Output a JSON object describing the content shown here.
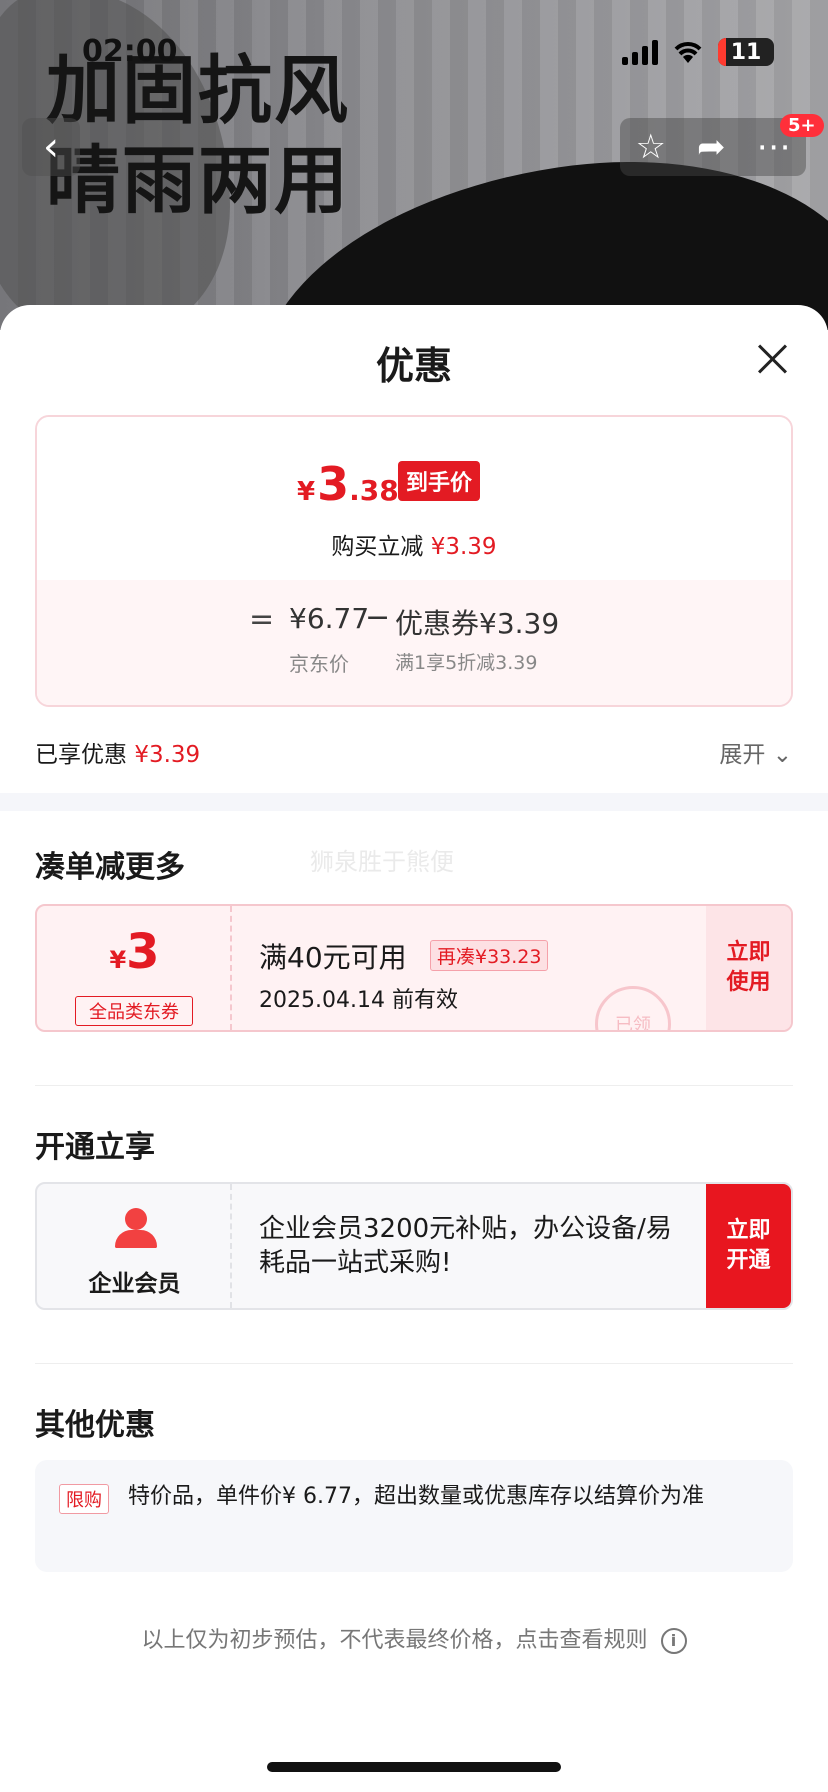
{
  "status_bar": {
    "time": "02:00",
    "battery": "11"
  },
  "hero": {
    "headline_line1": "加固抗风",
    "headline_line2": "晴雨两用",
    "badge": "5+"
  },
  "sheet": {
    "title": "优惠",
    "price": {
      "final_yen": "¥",
      "final_int": "3",
      "final_dec": ".38",
      "final_tag": "到手价",
      "reduce_text": "购买立减",
      "reduce_value": "¥3.39",
      "equals": "=",
      "jd_price": "¥6.77",
      "jd_label": "京东价",
      "minus": "−",
      "coupon_value": "优惠券¥3.39",
      "coupon_desc": "满1享5折减3.39"
    },
    "enjoyed_label": "已享优惠",
    "enjoyed_value": "¥3.39",
    "expand_label": "展开 ⌄",
    "watermark": "狮泉胜于熊便"
  },
  "section_more": {
    "title": "凑单减更多",
    "coupon": {
      "yen": "¥",
      "amount": "3",
      "kind": "全品类东券",
      "condition": "满40元可用",
      "more": "再凑¥33.23",
      "valid": "2025.04.14 前有效",
      "use_label": "立即\n使用",
      "stamp": "已领"
    }
  },
  "section_open": {
    "title": "开通立享",
    "member": {
      "label": "企业会员",
      "desc": "企业会员3200元补贴，办公设备/易耗品一站式采购!",
      "open_label": "立即\n开通"
    }
  },
  "section_other": {
    "title": "其他优惠",
    "tag": "限购",
    "text": "特价品，单件价¥ 6.77，超出数量或优惠库存以结算价为准"
  },
  "footer": {
    "text": "以上仅为初步预估，不代表最终价格，点击查看规则",
    "info": "i"
  },
  "colors": {
    "accent_red": "#e31b23",
    "soft_pink": "#fff2f3"
  }
}
